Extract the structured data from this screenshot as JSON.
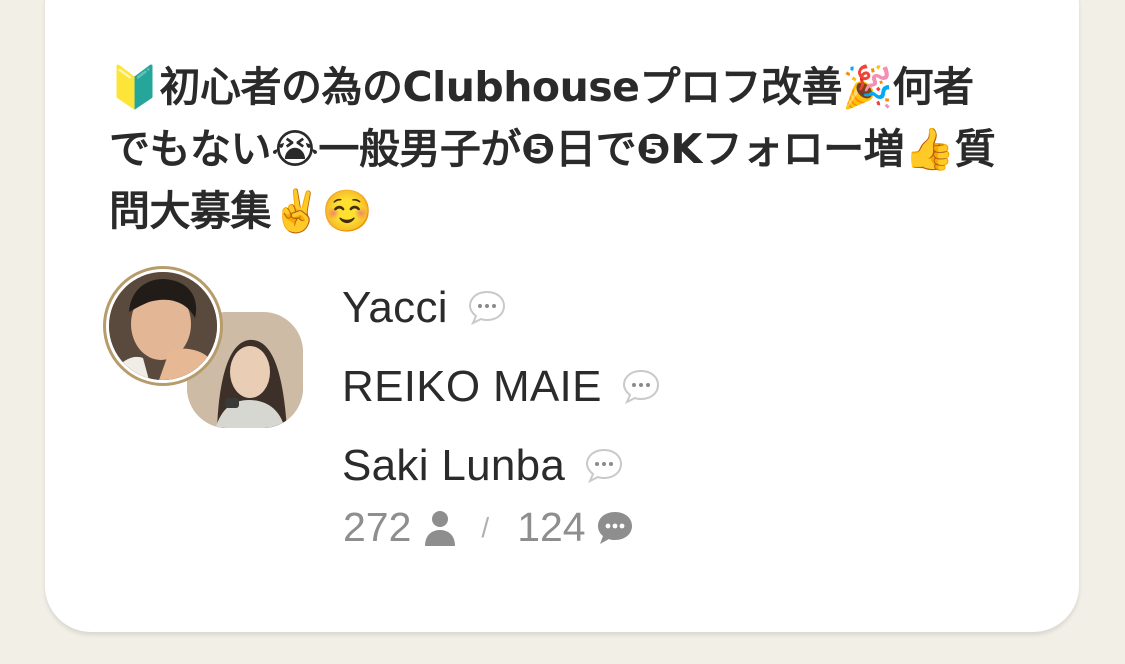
{
  "room": {
    "title": "🔰初心者の為のClubhouseプロフ改善🎉何者でもない😭一般男子が❺日で❺Kフォロー増👍質問大募集✌️☺️",
    "speakers": [
      {
        "name": "Yacci",
        "icon": "speech-bubble-icon"
      },
      {
        "name": "REIKO MAIE",
        "icon": "speech-bubble-icon"
      },
      {
        "name": "Saki Lunba",
        "icon": "speech-bubble-icon"
      }
    ],
    "stats": {
      "listeners": "272",
      "listeners_icon": "person-icon",
      "separator": "/",
      "speakers": "124",
      "speakers_icon": "chat-bubble-icon"
    }
  },
  "colors": {
    "background": "#f1efe6",
    "card": "#ffffff",
    "text": "#2b2b2b",
    "muted": "#8e8e8e",
    "avatar_ring": "#b79c6b"
  }
}
